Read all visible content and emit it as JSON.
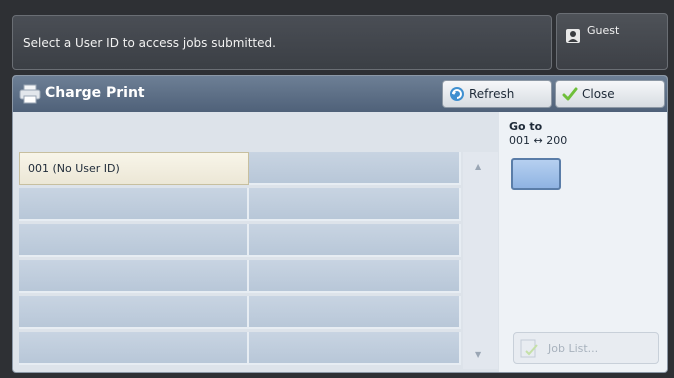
{
  "header": {
    "message": "Select a User ID to access jobs submitted.",
    "user_label": "Guest",
    "user_icon": "user-icon"
  },
  "panel": {
    "title": "Charge Print",
    "title_icon": "printer-icon",
    "refresh_label": "Refresh",
    "refresh_icon": "refresh-icon",
    "close_label": "Close",
    "close_icon": "checkmark-icon"
  },
  "list": {
    "items": [
      {
        "label": "001  (No User ID)",
        "selected": true
      }
    ]
  },
  "goto": {
    "label": "Go to",
    "range": "001 ↔ 200",
    "value": ""
  },
  "job_list": {
    "label": "Job List...",
    "icon": "job-list-icon",
    "enabled": false
  },
  "colors": {
    "title_bar": "#5d6f86",
    "selected_cell": "#f3efe0",
    "cell": "#c1cfdf",
    "accent": "#4a9fd5"
  }
}
